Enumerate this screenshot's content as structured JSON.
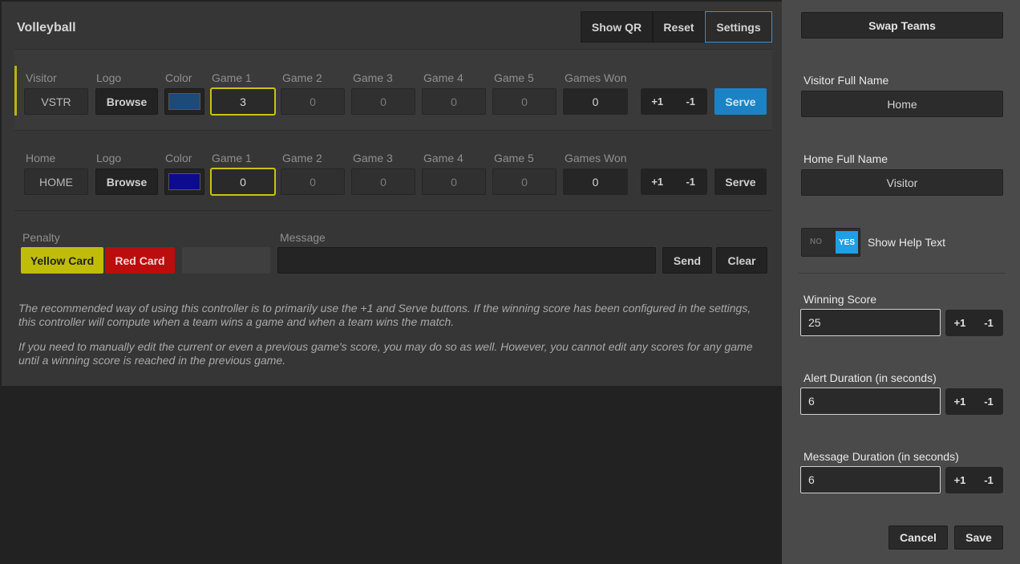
{
  "app_title": "Volleyball",
  "toolbar": {
    "show_qr": "Show QR",
    "reset": "Reset",
    "settings": "Settings"
  },
  "columns": {
    "logo": "Logo",
    "color": "Color",
    "game1": "Game 1",
    "game2": "Game 2",
    "game3": "Game 3",
    "game4": "Game 4",
    "game5": "Game 5",
    "games_won": "Games Won"
  },
  "visitor": {
    "label": "Visitor",
    "code": "VSTR",
    "browse": "Browse",
    "color": "#1e4a78",
    "games": [
      "3",
      "0",
      "0",
      "0",
      "0"
    ],
    "games_won": "0",
    "plus": "+1",
    "minus": "-1",
    "serve": "Serve",
    "serving": true
  },
  "home": {
    "label": "Home",
    "code": "HOME",
    "browse": "Browse",
    "color": "#0c0c8c",
    "games": [
      "0",
      "0",
      "0",
      "0",
      "0"
    ],
    "games_won": "0",
    "plus": "+1",
    "minus": "-1",
    "serve": "Serve",
    "serving": false
  },
  "penalty": {
    "label": "Penalty",
    "yellow": "Yellow Card",
    "red": "Red Card"
  },
  "message": {
    "label": "Message",
    "value": "",
    "send": "Send",
    "clear": "Clear"
  },
  "help": {
    "p1": "The recommended way of using this controller is to primarily use the +1 and Serve buttons. If the winning score has been configured in the settings, this controller will compute when a team wins a game and when a team wins the match.",
    "p2": "If you need to manually edit the current or even a previous game's score, you may do so as well. However, you cannot edit any scores for any game until a winning score is reached in the previous game."
  },
  "settings": {
    "swap_teams": "Swap Teams",
    "visitor_full_name_label": "Visitor Full Name",
    "visitor_full_name": "Home",
    "home_full_name_label": "Home Full Name",
    "home_full_name": "Visitor",
    "help_toggle": {
      "no": "NO",
      "yes": "YES",
      "label": "Show Help Text",
      "on": true
    },
    "winning_score": {
      "label": "Winning Score",
      "value": "25",
      "plus": "+1",
      "minus": "-1"
    },
    "alert_duration": {
      "label": "Alert Duration (in seconds)",
      "value": "6",
      "plus": "+1",
      "minus": "-1"
    },
    "message_duration": {
      "label": "Message Duration (in seconds)",
      "value": "6",
      "plus": "+1",
      "minus": "-1"
    },
    "cancel": "Cancel",
    "save": "Save"
  },
  "colors": {
    "serve_active": "#1c82c6",
    "serving_indicator": "#bcb216",
    "toggle_on": "#1ea0e6"
  }
}
